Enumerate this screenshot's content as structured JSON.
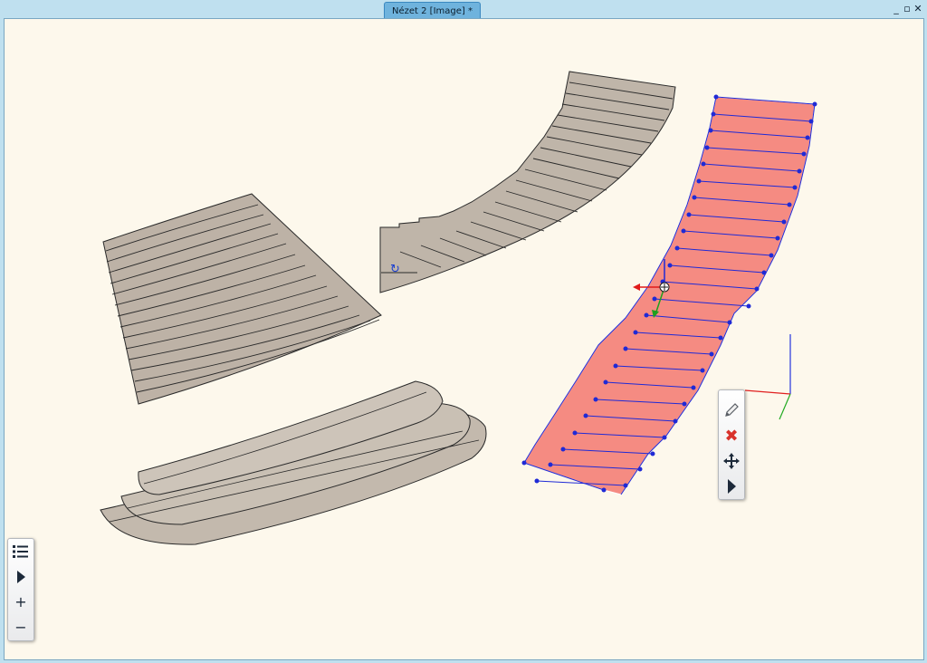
{
  "window": {
    "title": "Nézet 2 [Image] *"
  },
  "window_controls": {
    "minimize": "_",
    "restore": "▫",
    "close": "✕"
  },
  "left_toolbar": {
    "zoom_in": "+",
    "zoom_out": "−"
  },
  "edit_toolbar": {
    "delete": "✖"
  }
}
